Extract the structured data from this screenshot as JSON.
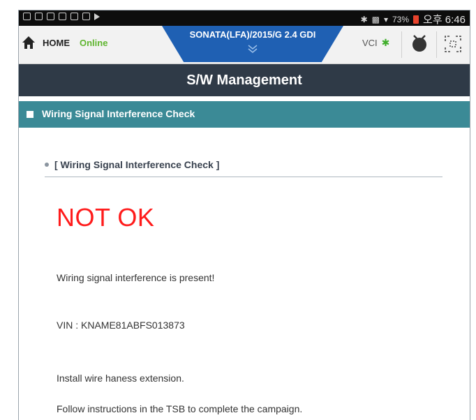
{
  "status_bar": {
    "left_icons": [
      "usb-icon",
      "image-icon",
      "mail-icon",
      "calendar-icon",
      "settings-icon",
      "cast-icon",
      "play-icon"
    ],
    "right_icons": [
      "bluetooth-icon",
      "mute-icon",
      "wifi-icon"
    ],
    "battery": "73%",
    "time": "오후 6:46"
  },
  "app_bar": {
    "home_label": "HOME",
    "connection_status": "Online",
    "vehicle": "SONATA(LFA)/2015/G 2.4 GDI",
    "vci_label": "VCI"
  },
  "title": "S/W Management",
  "section": {
    "title": "Wiring Signal Interference Check"
  },
  "content": {
    "subheading": "[ Wiring Signal Interference Check ]",
    "result": "NOT OK",
    "message": "Wiring signal interference is present!",
    "vin": "VIN : KNAME81ABFS013873",
    "instruction1": "Install wire haness extension.",
    "instruction2": "Follow instructions in the TSB to complete the campaign."
  },
  "colors": {
    "header_blue": "#1f60b3",
    "title_bar": "#2f3a47",
    "section_teal": "#3b8a96",
    "online_green": "#5fb52f",
    "result_red": "#ff1b1b"
  }
}
